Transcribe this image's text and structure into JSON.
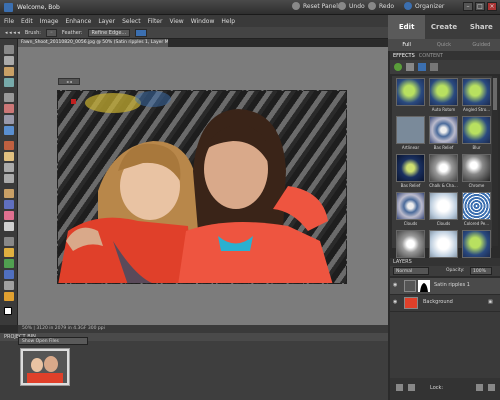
{
  "titlebar": {
    "welcome": "Welcome, Bob",
    "reset": "Reset Panels",
    "undo": "Undo",
    "redo": "Redo",
    "organizer": "Organizer"
  },
  "menu": [
    "File",
    "Edit",
    "Image",
    "Enhance",
    "Layer",
    "Select",
    "Filter",
    "View",
    "Window",
    "Help"
  ],
  "options": {
    "brush_label": "Brush:",
    "feather_label": "Feather:",
    "refine_edge": "Refine Edge..."
  },
  "doc_tab": "Fawn_Shoot_20110820_0056.jpg @ 50% (Satin ripples 1, Layer Mask/8) *",
  "right_tabs": [
    "Edit",
    "Create",
    "Share"
  ],
  "sub_tabs": [
    "Full",
    "Quick",
    "Guided"
  ],
  "effects": {
    "header": [
      "EFFECTS",
      "CONTENT"
    ],
    "items": [
      {
        "label": "",
        "style": "green-ball"
      },
      {
        "label": "Auto Rotom",
        "style": "green-ball"
      },
      {
        "label": "Angled Stro...",
        "style": "green-ball"
      },
      {
        "label": "Artlinear",
        "style": "flat-gray"
      },
      {
        "label": "Bas Relief",
        "style": "swirl"
      },
      {
        "label": "Blur",
        "style": "green-ball"
      },
      {
        "label": "Bas Relief",
        "style": "dark-blue"
      },
      {
        "label": "Chalk & Cha...",
        "style": "sketch"
      },
      {
        "label": "Chrome",
        "style": "chrome"
      },
      {
        "label": "Clouds",
        "style": "swirl"
      },
      {
        "label": "Clouds",
        "style": "light"
      },
      {
        "label": "Colored Pe...",
        "style": "halftone"
      },
      {
        "label": "",
        "style": "sketch"
      },
      {
        "label": "",
        "style": "light"
      },
      {
        "label": "",
        "style": "green-ball"
      }
    ]
  },
  "layers": {
    "header": "LAYERS",
    "mode": "Normal",
    "opacity_label": "Opacity:",
    "opacity": "100%",
    "rows": [
      {
        "name": "Satin ripples 1",
        "selected": true
      },
      {
        "name": "Background",
        "selected": false
      }
    ],
    "lock_label": "Lock:"
  },
  "status": "50% | 3120 in 2079 in 4.3GF 300 ppi ",
  "project_bin": {
    "header": "PROJECT BIN",
    "select_label": "Show Open Files"
  },
  "colors": {
    "accent": "#3b6fb0",
    "bg": "#2b2b2b",
    "canvas": "#7c7c7c"
  }
}
